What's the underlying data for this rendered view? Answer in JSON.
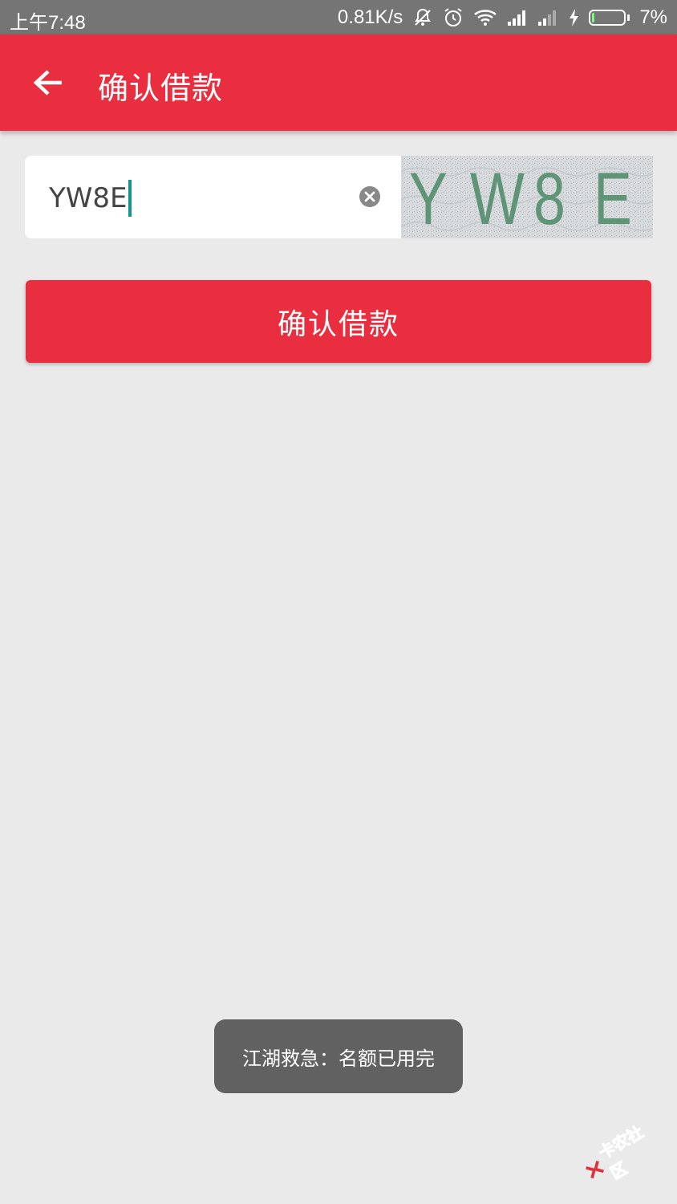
{
  "status_bar": {
    "time": "上午7:48",
    "net_speed": "0.81K/s",
    "battery_percent": "7%",
    "battery_level": 0.07,
    "icons": [
      "mute-icon",
      "alarm-icon",
      "wifi-icon",
      "signal-icon",
      "signal-weak-icon",
      "charging-icon",
      "battery-icon"
    ]
  },
  "app_bar": {
    "back_icon": "arrow-left-icon",
    "title": "确认借款"
  },
  "captcha": {
    "input_value": "YW8E",
    "clear_icon": "clear-icon",
    "image_chars": [
      "Y",
      "W",
      "8",
      "E"
    ]
  },
  "confirm_button": {
    "label": "确认借款"
  },
  "toast": {
    "message": "江湖救急：名额已用完"
  },
  "watermark": {
    "text": "卡农社区"
  },
  "colors": {
    "primary": "#E92F3F",
    "background": "#EAEAEA",
    "status_bar": "#757575",
    "caret": "#14968C",
    "captcha_text": "#5F9477",
    "toast_bg": "#616161"
  }
}
